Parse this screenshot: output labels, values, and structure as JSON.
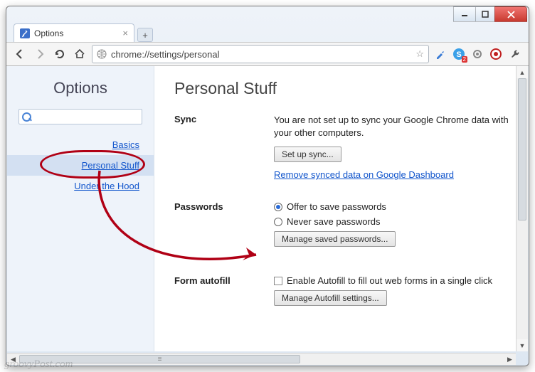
{
  "tab": {
    "title": "Options"
  },
  "omnibox": {
    "url": "chrome://settings/personal"
  },
  "extension_badge": "2",
  "sidebar": {
    "title": "Options",
    "items": [
      {
        "label": "Basics"
      },
      {
        "label": "Personal Stuff"
      },
      {
        "label": "Under the Hood"
      }
    ]
  },
  "page": {
    "title": "Personal Stuff",
    "sync": {
      "heading": "Sync",
      "text": "You are not set up to sync your Google Chrome data with your other computers.",
      "button": "Set up sync...",
      "link": "Remove synced data on Google Dashboard"
    },
    "passwords": {
      "heading": "Passwords",
      "opt_save": "Offer to save passwords",
      "opt_never": "Never save passwords",
      "button": "Manage saved passwords..."
    },
    "autofill": {
      "heading": "Form autofill",
      "check": "Enable Autofill to fill out web forms in a single click",
      "button": "Manage Autofill settings..."
    }
  },
  "watermark": "groovyPost.com"
}
